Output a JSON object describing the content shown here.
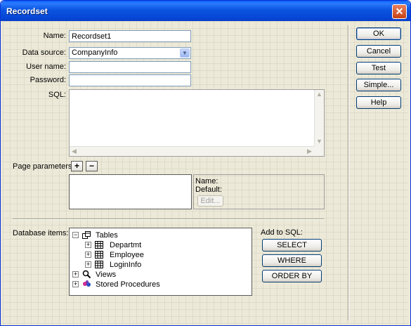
{
  "window": {
    "title": "Recordset",
    "close_glyph": "✕"
  },
  "form": {
    "name_label": "Name:",
    "name_value": "Recordset1",
    "datasource_label": "Data source:",
    "datasource_value": "CompanyInfo",
    "username_label": "User name:",
    "username_value": "",
    "password_label": "Password:",
    "password_value": "",
    "sql_label": "SQL:",
    "sql_value": ""
  },
  "page_params": {
    "label": "Page parameters:",
    "add_glyph": "+",
    "remove_glyph": "−",
    "name_label": "Name:",
    "default_label": "Default:",
    "edit_label": "Edit..."
  },
  "database": {
    "label": "Database items:",
    "tree": [
      {
        "label": "Tables",
        "icon": "tables-icon",
        "expanded": true,
        "level": 0
      },
      {
        "label": "Departmt",
        "icon": "table-icon",
        "level": 1
      },
      {
        "label": "Employee",
        "icon": "table-icon",
        "level": 1
      },
      {
        "label": "LoginInfo",
        "icon": "table-icon",
        "level": 1
      },
      {
        "label": "Views",
        "icon": "views-icon",
        "level": 0
      },
      {
        "label": "Stored Procedures",
        "icon": "stored-procedures-icon",
        "level": 0
      }
    ]
  },
  "add_to_sql": {
    "label": "Add to SQL:",
    "select_label": "SELECT",
    "where_label": "WHERE",
    "orderby_label": "ORDER BY"
  },
  "side_buttons": {
    "ok": "OK",
    "cancel": "Cancel",
    "test": "Test",
    "simple": "Simple...",
    "help": "Help"
  },
  "colors": {
    "titlebar": "#0a5ff6",
    "dialog_bg": "#ece9d8",
    "close_button": "#c64216"
  }
}
